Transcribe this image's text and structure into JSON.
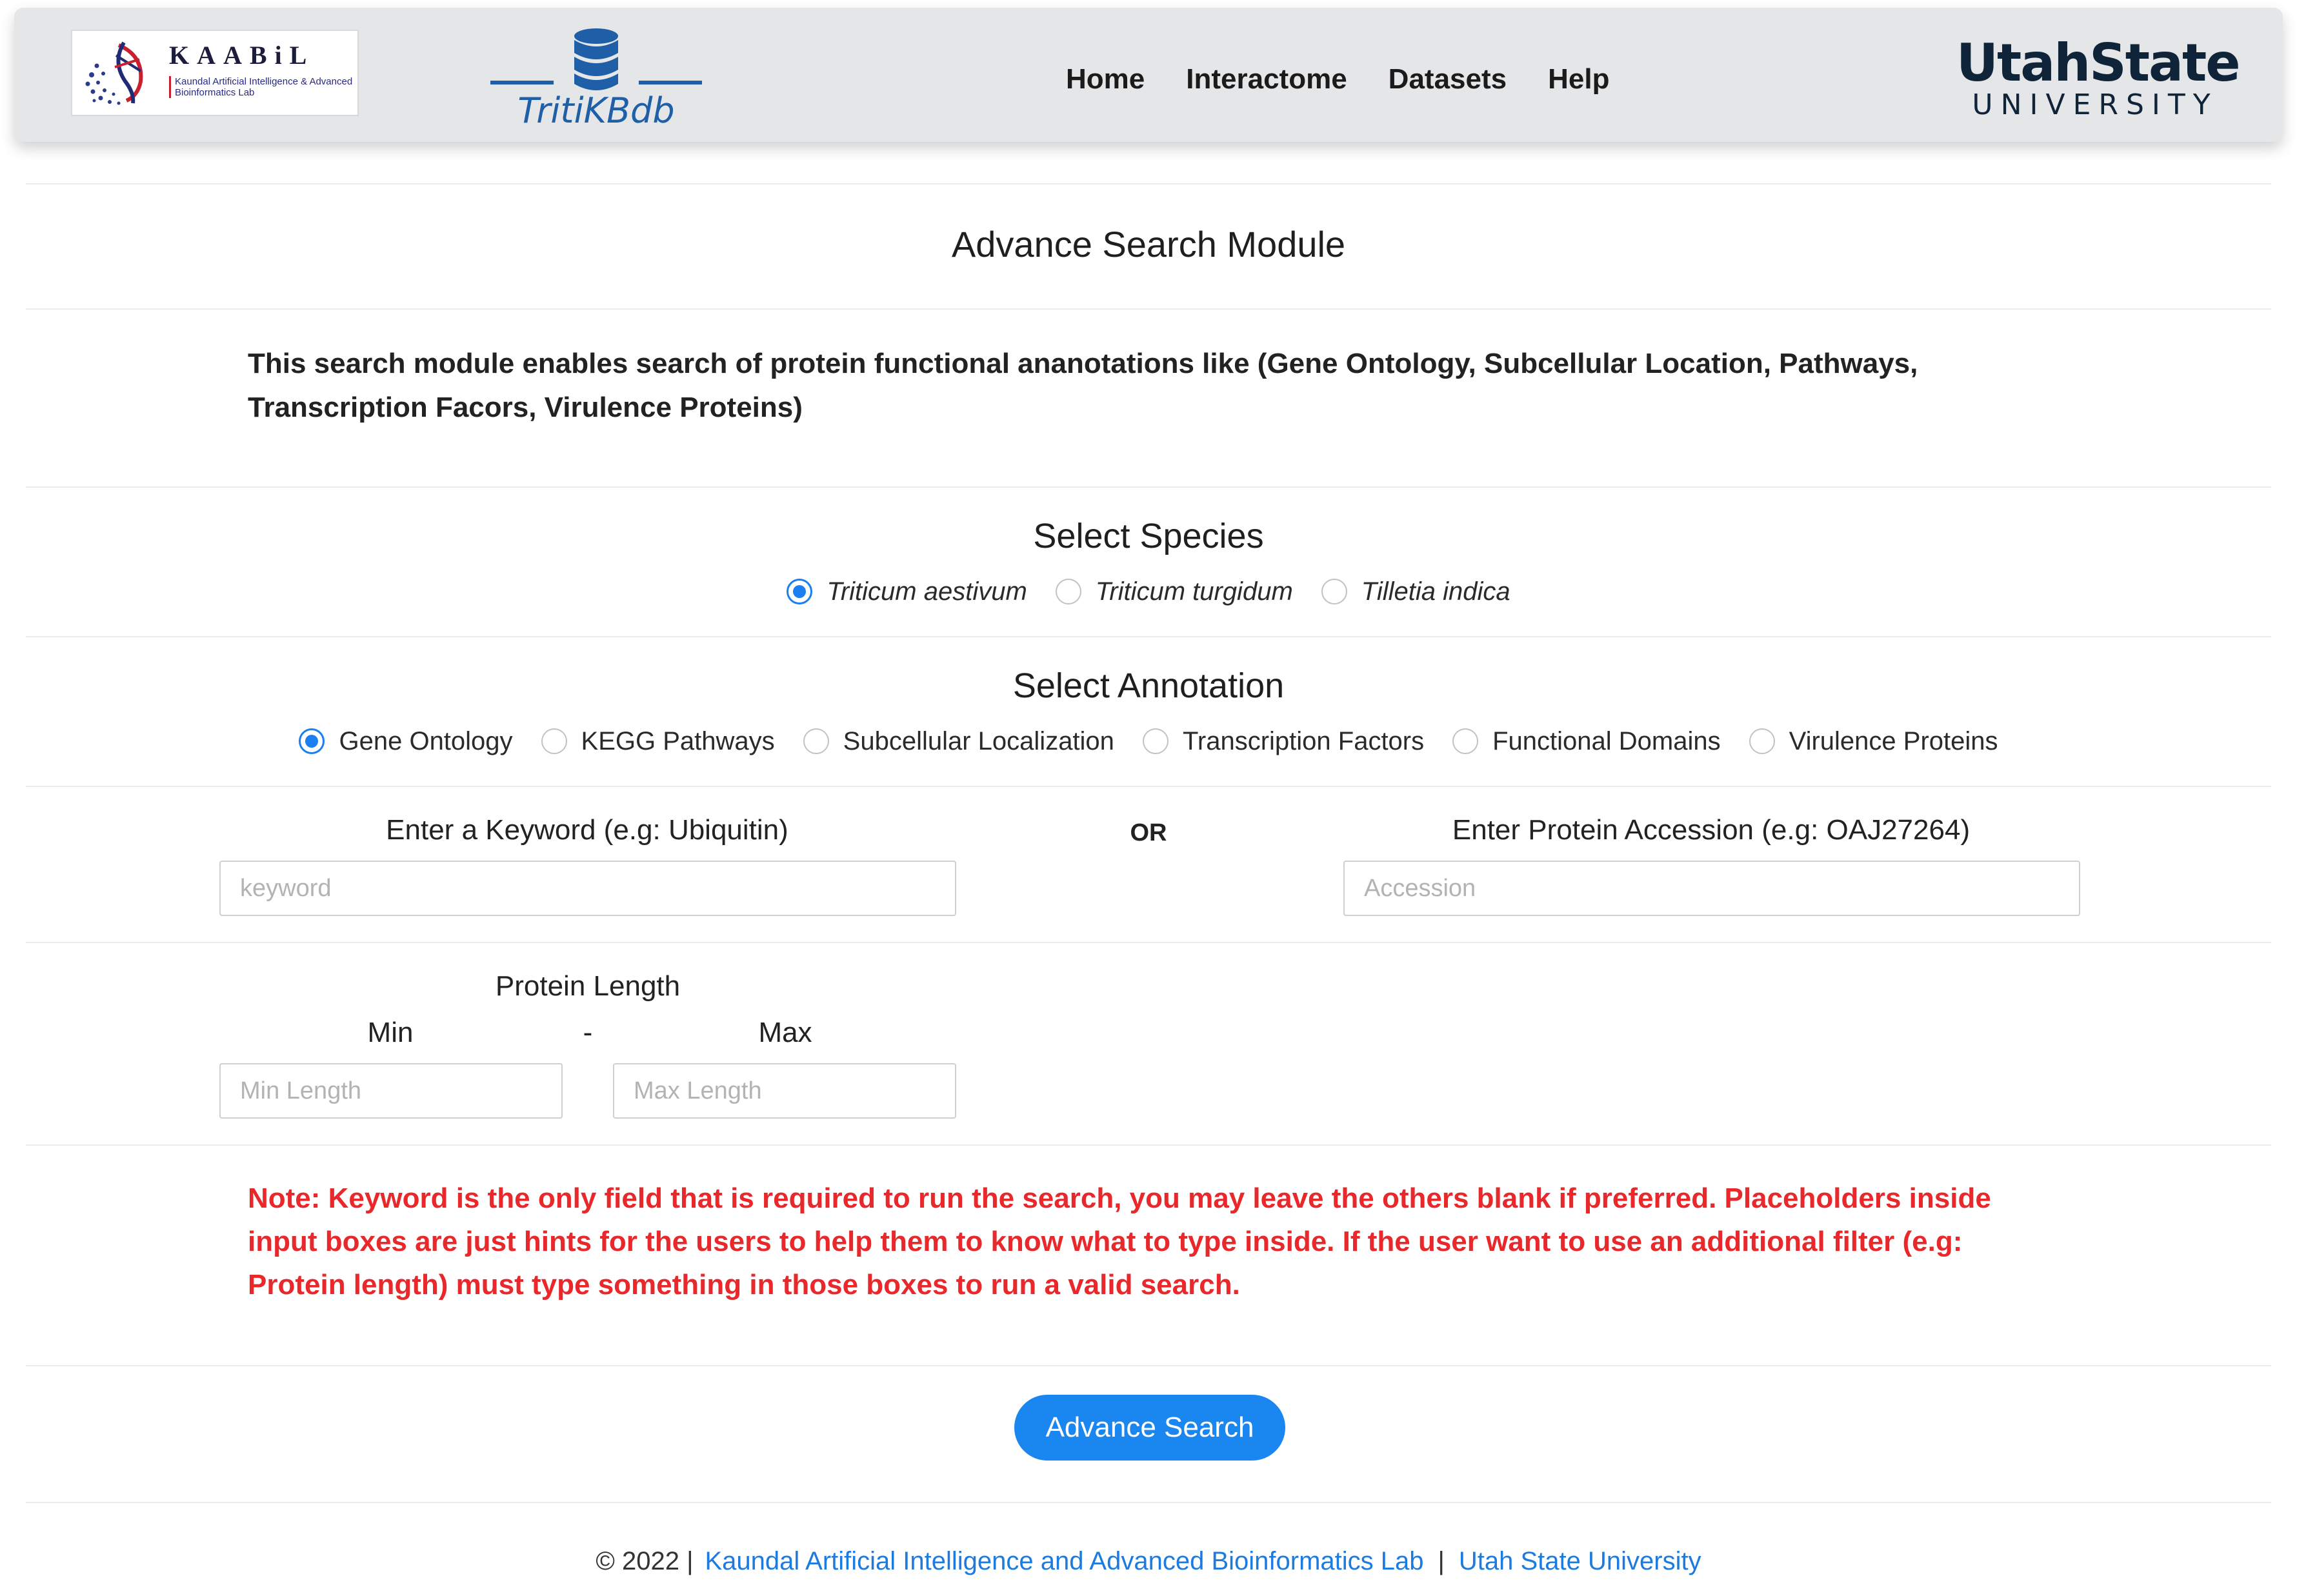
{
  "header": {
    "kaabil_logo": {
      "title": "KAABiL",
      "subtitle": "Kaundal Artificial Intelligence & Advanced Bioinformatics Lab"
    },
    "tritik_logo": {
      "label": "TritiKBdb"
    },
    "nav": [
      {
        "label": "Home"
      },
      {
        "label": "Interactome"
      },
      {
        "label": "Datasets"
      },
      {
        "label": "Help"
      }
    ],
    "usu_logo": {
      "top": "UtahState",
      "bottom": "UNIVERSITY"
    }
  },
  "page": {
    "title": "Advance Search Module",
    "intro": "This search module enables search of protein functional ananotations like (Gene Ontology, Subcellular Location, Pathways, Transcription Facors, Virulence Proteins)"
  },
  "species": {
    "title": "Select Species",
    "options": [
      {
        "label": "Triticum aestivum",
        "checked": true
      },
      {
        "label": "Triticum turgidum",
        "checked": false
      },
      {
        "label": "Tilletia indica",
        "checked": false
      }
    ]
  },
  "annotation": {
    "title": "Select Annotation",
    "options": [
      {
        "label": "Gene Ontology",
        "checked": true
      },
      {
        "label": "KEGG Pathways",
        "checked": false
      },
      {
        "label": "Subcellular Localization",
        "checked": false
      },
      {
        "label": "Transcription Factors",
        "checked": false
      },
      {
        "label": "Functional Domains",
        "checked": false
      },
      {
        "label": "Virulence Proteins",
        "checked": false
      }
    ]
  },
  "keyword": {
    "label": "Enter a Keyword (e.g: Ubiquitin)",
    "placeholder": "keyword",
    "value": ""
  },
  "or_label": "OR",
  "accession": {
    "label": "Enter Protein Accession (e.g: OAJ27264)",
    "placeholder": "Accession",
    "value": ""
  },
  "protein_length": {
    "title": "Protein Length",
    "min_label": "Min",
    "dash": "-",
    "max_label": "Max",
    "min_placeholder": "Min Length",
    "max_placeholder": "Max Length"
  },
  "note": "Note: Keyword is the only field that is required to run the search, you may leave the others blank if preferred. Placeholders inside input boxes are just hints for the users to help them to know what to type inside. If the user want to use an additional filter (e.g: Protein length) must type something in those boxes to run a valid search.",
  "search_button": {
    "label": "Advance Search"
  },
  "footer": {
    "copyright": "© 2022 |",
    "lab_link": "Kaundal Artificial Intelligence and Advanced Bioinformatics Lab",
    "separator": "|",
    "university_link": "Utah State University"
  },
  "colors": {
    "accent": "#1a86ef",
    "note_text": "#e8282b",
    "link": "#1d7be0",
    "navbar_bg": "#e4e6e8"
  }
}
